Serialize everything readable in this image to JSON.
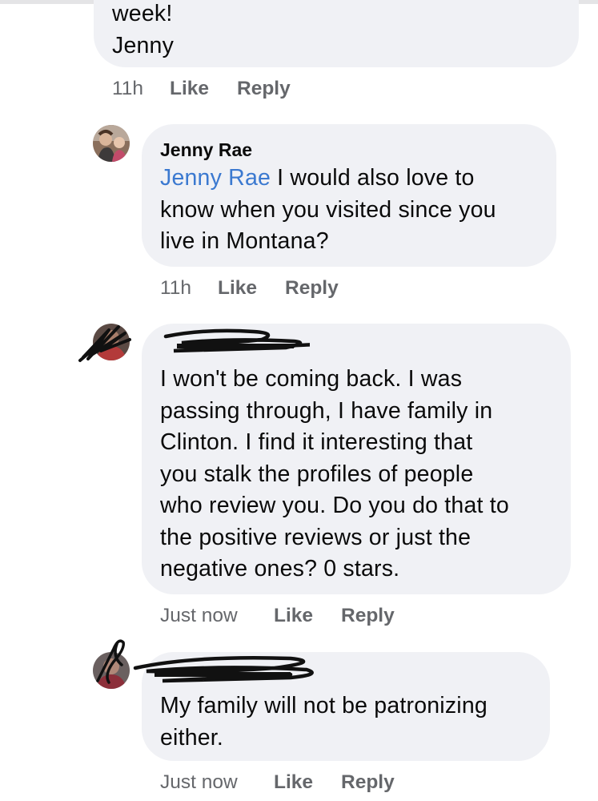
{
  "comments": [
    {
      "name": "",
      "lines": [
        "week!",
        "Jenny"
      ],
      "time": "11h",
      "like": "Like",
      "reply": "Reply"
    },
    {
      "name": "Jenny Rae",
      "mention": "Jenny Rae",
      "text_after_mention": " I would also love to",
      "lines": [
        "know when you visited since you",
        "live in Montana?"
      ],
      "time": "11h",
      "like": "Like",
      "reply": "Reply"
    },
    {
      "name": "",
      "lines": [
        "I won't be coming back. I was",
        "passing through, I have family in",
        "Clinton. I find it interesting that",
        "you stalk the profiles of people",
        "who review you. Do you do that to",
        "the positive reviews or just the",
        "negative ones? 0 stars."
      ],
      "time": "Just now",
      "like": "Like",
      "reply": "Reply"
    },
    {
      "name": "",
      "lines": [
        "My family will not be patronizing",
        "either."
      ],
      "time": "Just now",
      "like": "Like",
      "reply": "Reply"
    }
  ]
}
